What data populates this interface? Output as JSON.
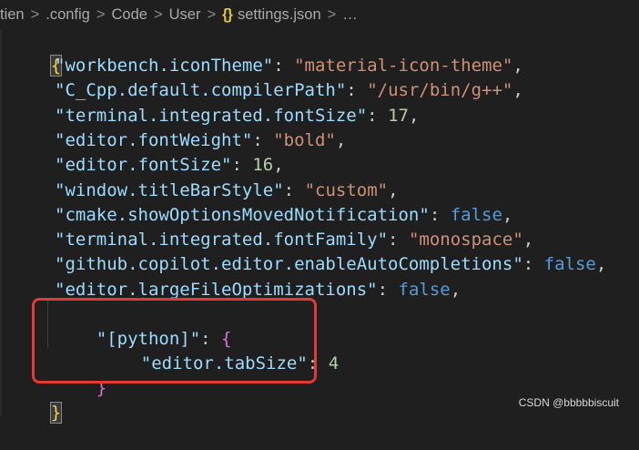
{
  "breadcrumb": {
    "items": [
      "tien",
      ".config",
      "Code",
      "User",
      "settings.json",
      "…"
    ],
    "separator": ">",
    "file_icon": "{}"
  },
  "editor": {
    "open_brace": "{",
    "close_brace": "}",
    "settings": [
      {
        "key": "\"workbench.iconTheme\"",
        "value": "\"material-icon-theme\"",
        "type": "string"
      },
      {
        "key": "\"C_Cpp.default.compilerPath\"",
        "value": "\"/usr/bin/g++\"",
        "type": "string"
      },
      {
        "key": "\"terminal.integrated.fontSize\"",
        "value": "17",
        "type": "number"
      },
      {
        "key": "\"editor.fontWeight\"",
        "value": "\"bold\"",
        "type": "string"
      },
      {
        "key": "\"editor.fontSize\"",
        "value": "16",
        "type": "number"
      },
      {
        "key": "\"window.titleBarStyle\"",
        "value": "\"custom\"",
        "type": "string"
      },
      {
        "key": "\"cmake.showOptionsMovedNotification\"",
        "value": "false",
        "type": "boolean"
      },
      {
        "key": "\"terminal.integrated.fontFamily\"",
        "value": "\"monospace\"",
        "type": "string"
      },
      {
        "key": "\"github.copilot.editor.enableAutoCompletions\"",
        "value": "false",
        "type": "boolean"
      },
      {
        "key": "\"editor.largeFileOptimizations\"",
        "value": "false",
        "type": "boolean"
      }
    ],
    "python_block": {
      "key": "\"[python]\"",
      "open": "{",
      "inner_key": "\"editor.tabSize\"",
      "inner_value": "4",
      "close": "}"
    },
    "colon": ": ",
    "comma": ","
  },
  "watermark": "CSDN @bbbbbiscuit",
  "colors": {
    "background": "#1f1f1f",
    "key": "#9cdcfe",
    "string": "#ce9178",
    "number": "#b5cea8",
    "boolean": "#569cd6",
    "highlight_box": "#e53935"
  }
}
